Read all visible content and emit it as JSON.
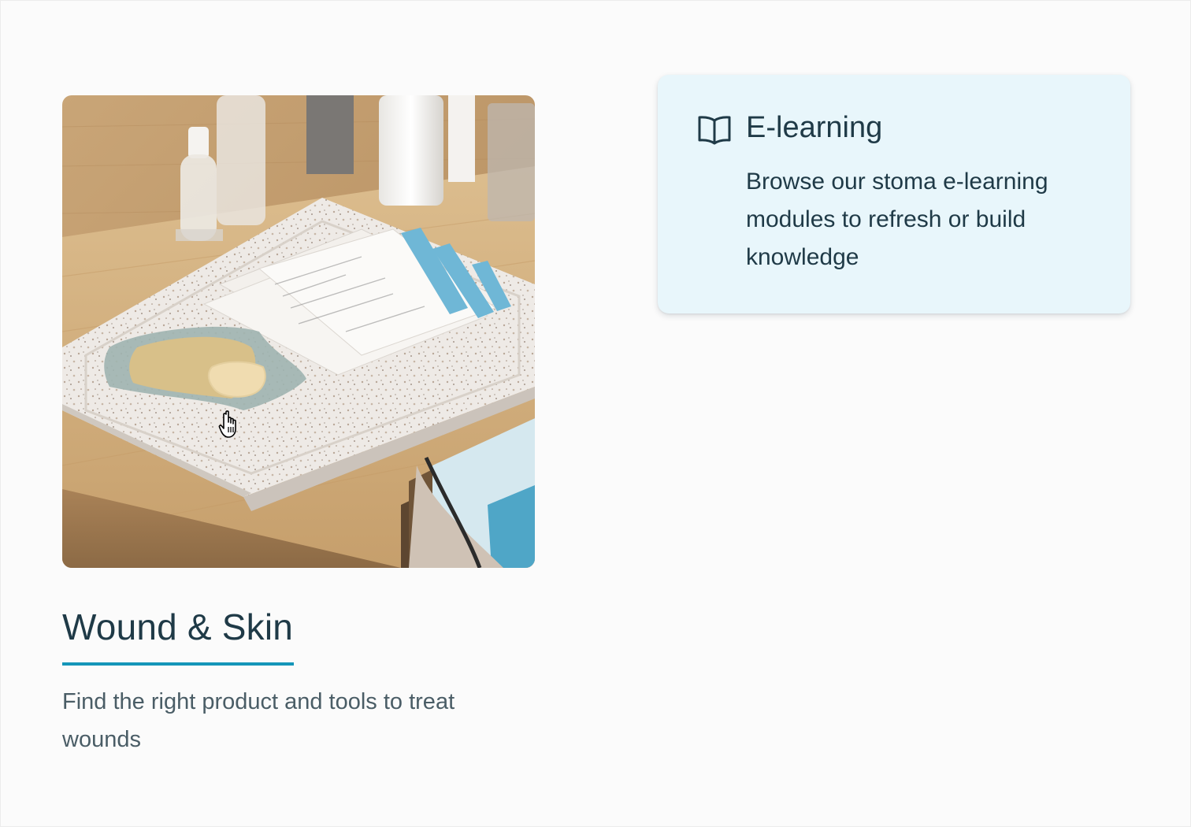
{
  "feature": {
    "title": "Wound & Skin",
    "description": "Find the right product and tools to treat wounds",
    "image_icon": "wound-care-products-photo",
    "accent_color": "#1496b9"
  },
  "elearning": {
    "icon": "book-icon",
    "title": "E-learning",
    "description": "Browse our stoma e-learning modules to refresh or build knowledge",
    "background_color": "#e8f6fb"
  },
  "colors": {
    "text_dark": "#1f3a47",
    "text_muted": "#4a5d66",
    "page_background": "#fbfbfb"
  }
}
